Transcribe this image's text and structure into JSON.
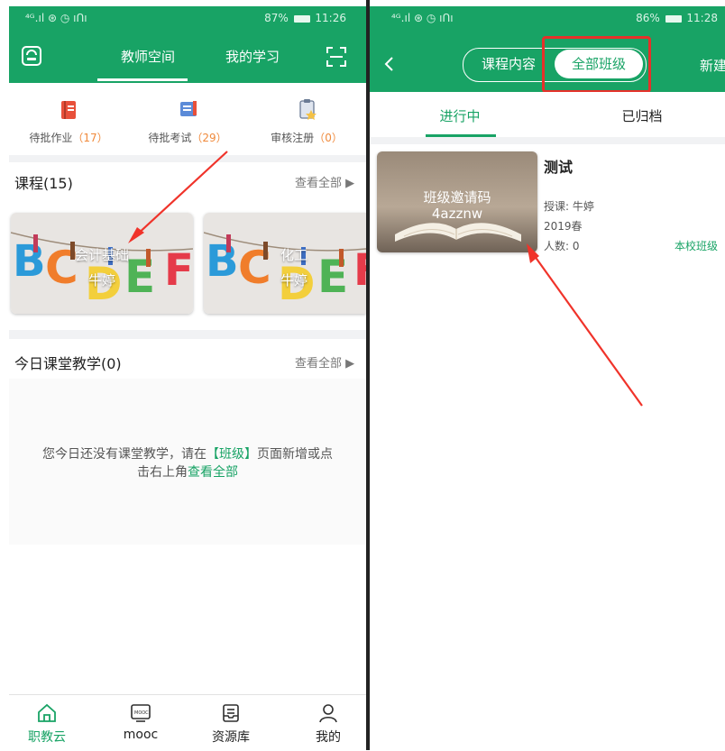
{
  "left": {
    "status": {
      "signal": "⁴ᴳ.ıl ⊛ ◷ ıᑎı",
      "battery": "87%",
      "time": "11:26"
    },
    "header": {
      "tabs": [
        "教师空间",
        "我的学习"
      ],
      "active_tab": 0
    },
    "quick": [
      {
        "label": "待批作业",
        "count": "17"
      },
      {
        "label": "待批考试",
        "count": "29"
      },
      {
        "label": "审核注册",
        "count": "0"
      }
    ],
    "courses": {
      "title": "课程(15)",
      "view_all": "查看全部 ▶",
      "items": [
        {
          "name": "会计基础",
          "teacher": "牛婷"
        },
        {
          "name": "化工",
          "teacher": "牛婷"
        }
      ]
    },
    "today": {
      "title": "今日课堂教学(0)",
      "view_all": "查看全部 ▶",
      "empty_text_1": "您今日还没有课堂教学，请在",
      "empty_bracket": "【班级】",
      "empty_text_2": "页面新增或点",
      "empty_text_3": "击右上角",
      "empty_link": "查看全部"
    },
    "tabbar": [
      {
        "label": "职教云",
        "icon": "home-icon"
      },
      {
        "label": "mooc",
        "icon": "mooc-icon"
      },
      {
        "label": "资源库",
        "icon": "archive-icon"
      },
      {
        "label": "我的",
        "icon": "user-icon"
      }
    ],
    "accent": "#18a365"
  },
  "right": {
    "status": {
      "signal": "⁴ᴳ.ıl ⊛ ◷ ıᑎı",
      "battery": "86%",
      "time": "11:28"
    },
    "header": {
      "tabs": [
        "课程内容",
        "全部班级"
      ],
      "active_tab": 1,
      "new_label": "新建"
    },
    "subtabs": [
      "进行中",
      "已归档"
    ],
    "class": {
      "cover_title": "班级邀请码",
      "cover_code": "4azznw",
      "name": "测试",
      "teacher": "授课: 牛婷",
      "term": "2019春",
      "count": "人数: 0",
      "tag": "本校班级"
    }
  },
  "colors": {
    "green": "#18a365",
    "orange": "#f08a3c",
    "red": "#e5312a"
  }
}
